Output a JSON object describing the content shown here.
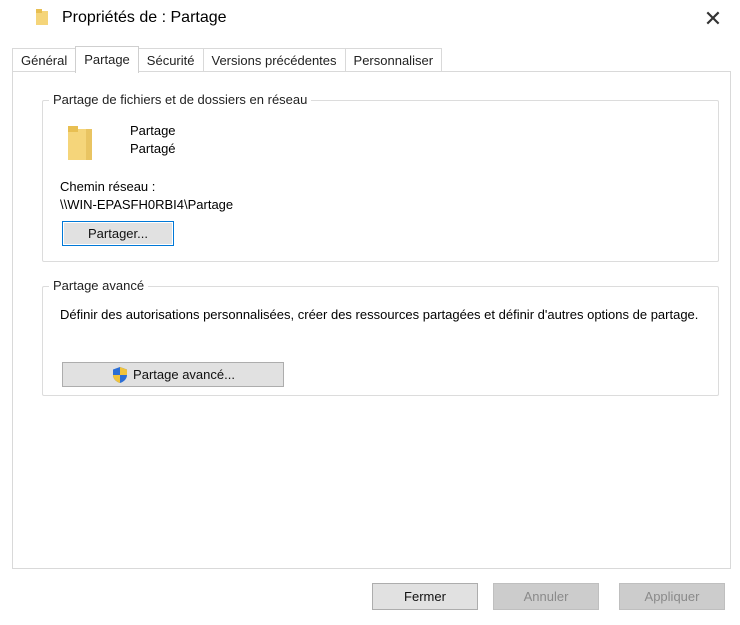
{
  "window": {
    "title": "Propriétés de : Partage",
    "close_glyph": "✕"
  },
  "tabs": [
    {
      "label": "Général"
    },
    {
      "label": "Partage"
    },
    {
      "label": "Sécurité"
    },
    {
      "label": "Versions précédentes"
    },
    {
      "label": "Personnaliser"
    }
  ],
  "network_share": {
    "legend": "Partage de fichiers et de dossiers en réseau",
    "folder_name": "Partage",
    "status": "Partagé",
    "path_label": "Chemin réseau :",
    "path_value": "\\\\WIN-EPASFH0RBI4\\Partage",
    "share_button": "Partager..."
  },
  "advanced_share": {
    "legend": "Partage avancé",
    "description": "Définir des autorisations personnalisées, créer des ressources partagées et définir d'autres options de partage.",
    "button": "Partage avancé..."
  },
  "footer": {
    "close": "Fermer",
    "cancel": "Annuler",
    "apply": "Appliquer"
  },
  "colors": {
    "folder": "#f5d57a",
    "focus_border": "#0078d7",
    "disabled_text": "#8a8a8a"
  },
  "icons": {
    "title": "folder-icon",
    "folder": "folder-icon",
    "shield": "uac-shield-icon"
  }
}
